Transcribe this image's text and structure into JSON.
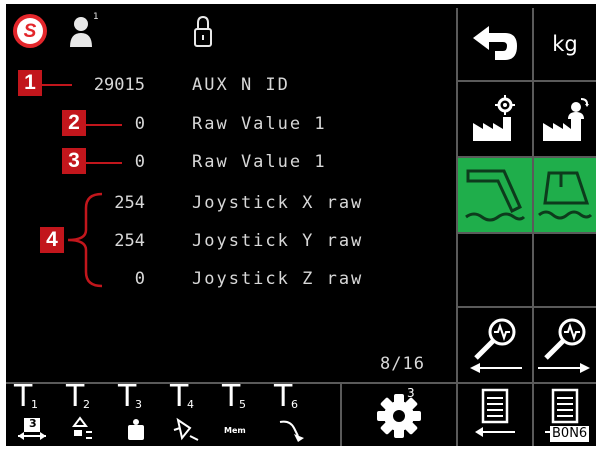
{
  "header": {
    "logo_letter": "S",
    "user_superscript": "1"
  },
  "rows": [
    {
      "callout": "1",
      "value": "29015",
      "label": "AUX N ID"
    },
    {
      "callout": "2",
      "value": "0",
      "label": "Raw Value 1"
    },
    {
      "callout": "3",
      "value": "0",
      "label": "Raw Value 1"
    },
    {
      "value": "254",
      "label": "Joystick X raw"
    },
    {
      "value": "254",
      "label": "Joystick Y raw"
    },
    {
      "value": "0",
      "label": "Joystick Z raw"
    }
  ],
  "group_callout": "4",
  "page_indicator": "8/16",
  "right_panel": {
    "unit_label": "kg",
    "icons": [
      "back-arrow-icon",
      "factory-settings-icon",
      "factory-restore-icon",
      "boom-icon",
      "bucket-icon",
      "search-prev-icon",
      "search-next-icon",
      "list-prev-icon",
      "list-next-icon"
    ],
    "active_color": "#1fae4b"
  },
  "toolbar": {
    "tools": [
      {
        "label": "T",
        "sub": "1",
        "badge": "3"
      },
      {
        "label": "T",
        "sub": "2"
      },
      {
        "label": "T",
        "sub": "3"
      },
      {
        "label": "T",
        "sub": "4"
      },
      {
        "label": "T",
        "sub": "5",
        "mini_text": "Mem"
      },
      {
        "label": "T",
        "sub": "6"
      }
    ],
    "settings_superscript": "3"
  },
  "image_code": "B0N6",
  "colors": {
    "callout_red": "#c2161c",
    "logo_red": "#e3262b",
    "active_green": "#1fae4b"
  }
}
